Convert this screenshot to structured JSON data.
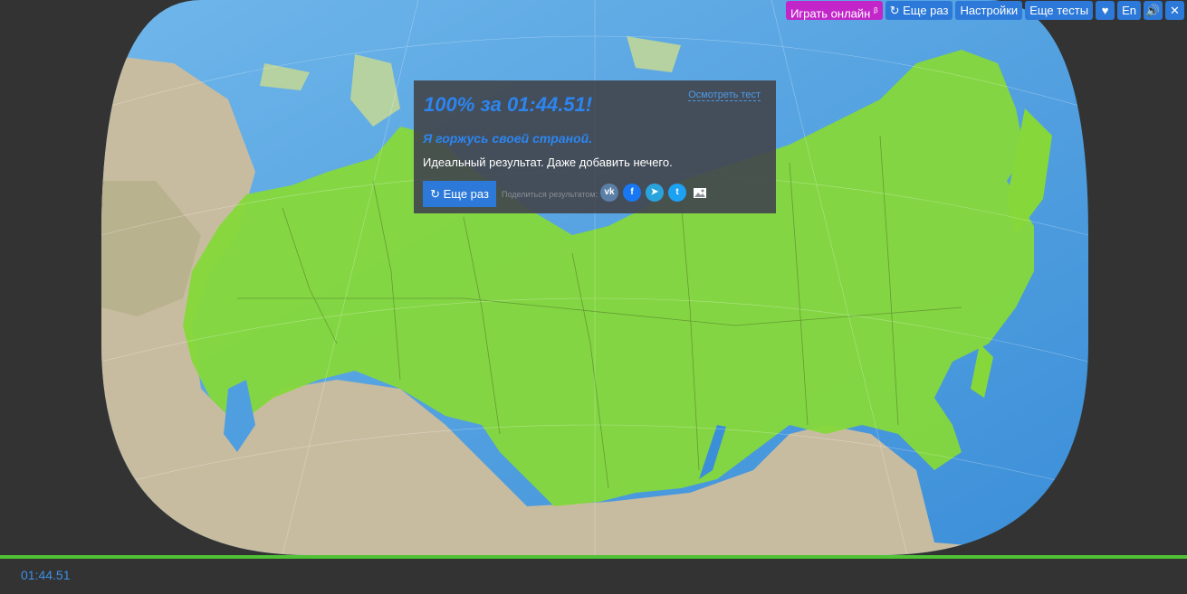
{
  "topbar": {
    "play_online_label": "Играть онлайн",
    "play_online_beta": "β",
    "again_label": "Еще раз",
    "settings_label": "Настройки",
    "more_tests_label": "Еще тесты",
    "language_label": "En"
  },
  "result": {
    "score_text": "100% за 01:44.51!",
    "review_link": "Осмотреть тест",
    "proud_text": "Я горжусь своей страной.",
    "description": "Идеальный результат. Даже добавить нечего.",
    "again_button": "Еще раз",
    "share_label": "Поделиться результатом:",
    "share_icons": [
      "vk-icon",
      "facebook-icon",
      "telegram-icon",
      "twitter-icon",
      "image-icon"
    ]
  },
  "progress": {
    "fraction": 1.0
  },
  "timer": {
    "value": "01:44.51"
  },
  "colors": {
    "accent": "#2c79d9",
    "online": "#c226c9",
    "progress": "#4fc235",
    "land_selected": "#86d83a",
    "water": "#5aa7e3"
  }
}
